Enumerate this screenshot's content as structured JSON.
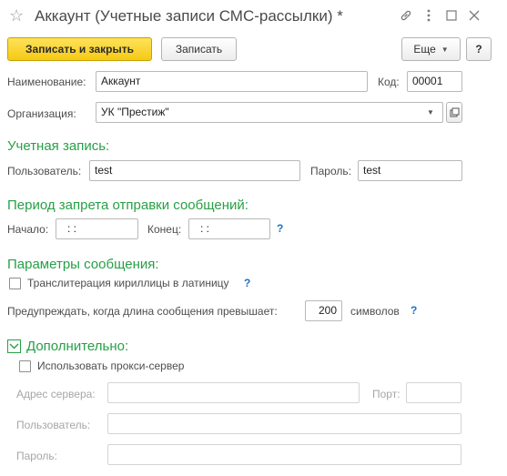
{
  "window": {
    "title": "Аккаунт (Учетные записи СМС-рассылки) *",
    "icons": [
      "star-icon",
      "link-icon",
      "more-vert-icon",
      "maximize-icon",
      "close-icon"
    ]
  },
  "toolbar": {
    "save_close_label": "Записать и закрыть",
    "save_label": "Записать",
    "more_label": "Еще",
    "help_label": "?"
  },
  "fields": {
    "name_label": "Наименование:",
    "name_value": "Аккаунт",
    "code_label": "Код:",
    "code_value": "00001",
    "org_label": "Организация:",
    "org_value": "УК \"Престиж\""
  },
  "account": {
    "heading": "Учетная запись:",
    "user_label": "Пользователь:",
    "user_value": "test",
    "password_label": "Пароль:",
    "password_value": "test"
  },
  "period": {
    "heading": "Период запрета отправки сообщений:",
    "start_label": "Начало:",
    "start_value": ":  :",
    "end_label": "Конец:",
    "end_value": ":  :",
    "help": "?"
  },
  "params": {
    "heading": "Параметры сообщения:",
    "translit_label": "Транслитерация кириллицы в латиницу",
    "translit_checked": false,
    "translit_help": "?",
    "warn_label": "Предупреждать, когда длина сообщения превышает:",
    "warn_value": "200",
    "warn_unit": "символов",
    "warn_help": "?"
  },
  "extra": {
    "heading": "Дополнительно:",
    "expanded": true,
    "proxy_label": "Использовать прокси-сервер",
    "proxy_checked": false,
    "server_label": "Адрес сервера:",
    "server_value": "",
    "port_label": "Порт:",
    "port_value": "",
    "proxy_user_label": "Пользователь:",
    "proxy_user_value": "",
    "proxy_password_label": "Пароль:",
    "proxy_password_value": ""
  },
  "colors": {
    "section_heading": "#27a047",
    "primary_button": "#f6c914",
    "help_mark": "#1f6fc6"
  }
}
